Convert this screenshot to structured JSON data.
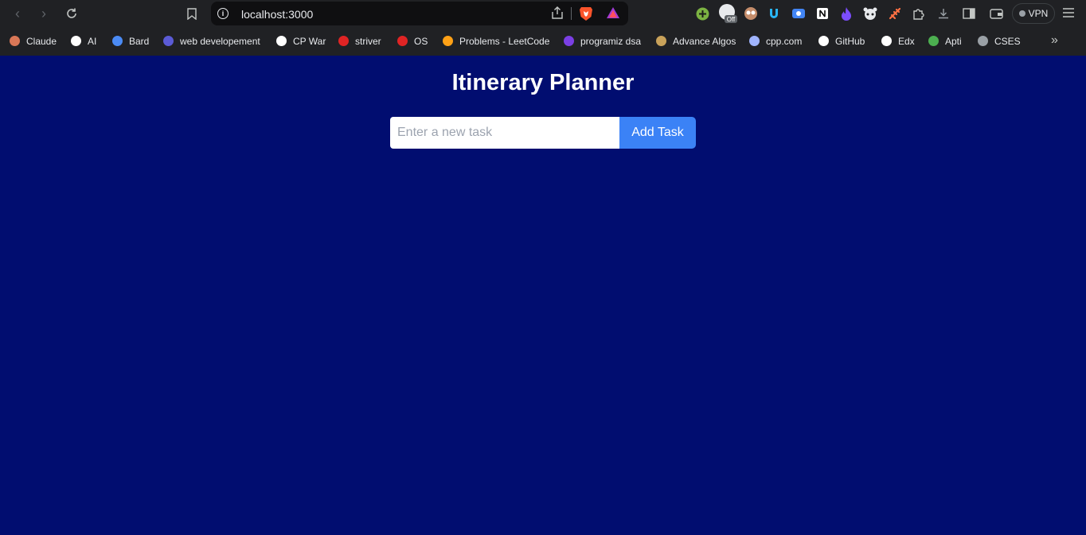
{
  "browser": {
    "url": "localhost:3000",
    "nav": {
      "back_icon": "back-arrow-icon",
      "forward_icon": "forward-arrow-icon",
      "reload_icon": "reload-icon"
    },
    "extensions_badge": "Off",
    "vpn_label": "VPN",
    "bookmarks": [
      {
        "label": "Claude",
        "icon": "claude-icon",
        "color": "#d97757"
      },
      {
        "label": "AI",
        "icon": "openai-icon",
        "color": "#ffffff"
      },
      {
        "label": "Bard",
        "icon": "bard-icon",
        "color": "#4b8bf5"
      },
      {
        "label": "web developement",
        "icon": "code-icon",
        "color": "#5b5bd6"
      },
      {
        "label": "CP War",
        "icon": "cpwar-icon",
        "color": "#ffffff"
      },
      {
        "label": "striver",
        "icon": "tuf-icon",
        "color": "#e02424"
      },
      {
        "label": "OS",
        "icon": "os-icon",
        "color": "#e02424"
      },
      {
        "label": "Problems - LeetCode",
        "icon": "leetcode-icon",
        "color": "#ffa116"
      },
      {
        "label": "programiz dsa",
        "icon": "programiz-icon",
        "color": "#7b3fe4"
      },
      {
        "label": "Advance Algos",
        "icon": "algos-icon",
        "color": "#c9a25a"
      },
      {
        "label": "cpp.com",
        "icon": "cpp-icon",
        "color": "#a0b4ff"
      },
      {
        "label": "GitHub",
        "icon": "github-icon",
        "color": "#ffffff"
      },
      {
        "label": "Edx",
        "icon": "edx-icon",
        "color": "#ffffff"
      },
      {
        "label": "Apti",
        "icon": "apti-icon",
        "color": "#4caf50"
      },
      {
        "label": "CSES",
        "icon": "globe-icon",
        "color": "#9aa0a6"
      }
    ]
  },
  "app": {
    "title": "Itinerary Planner",
    "input_placeholder": "Enter a new task",
    "input_value": "",
    "add_button_label": "Add Task",
    "colors": {
      "background": "#010d70",
      "button": "#3b82f6"
    }
  }
}
